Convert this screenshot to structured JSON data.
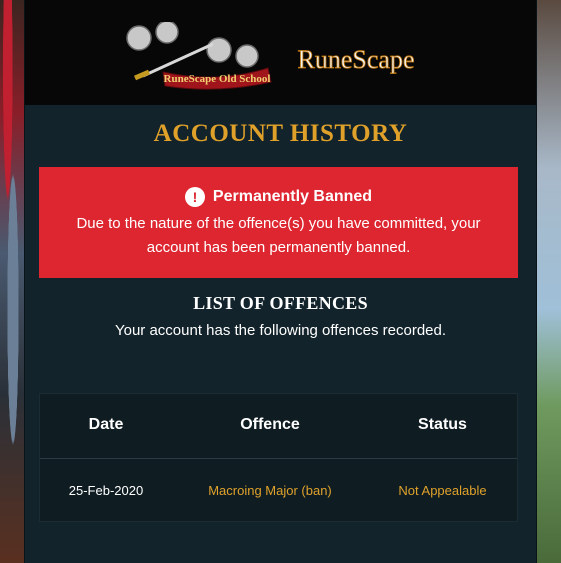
{
  "header": {
    "osrs_logo_text": "RuneScape Old School",
    "rs_logo_text": "RuneScape"
  },
  "page_title": "ACCOUNT HISTORY",
  "ban_notice": {
    "title": "Permanently Banned",
    "icon": "exclamation-circle-icon",
    "message": "Due to the nature of the offence(s) you have committed, your account has been permanently banned."
  },
  "offences": {
    "title": "LIST OF OFFENCES",
    "description": "Your account has the following offences recorded.",
    "columns": [
      "Date",
      "Offence",
      "Status"
    ],
    "rows": [
      {
        "date": "25-Feb-2020",
        "offence": "Macroing Major (ban)",
        "status": "Not Appealable"
      }
    ]
  },
  "colors": {
    "panel": "#12232b",
    "accent_gold": "#e0a12a",
    "ban_red": "#dd2630"
  }
}
